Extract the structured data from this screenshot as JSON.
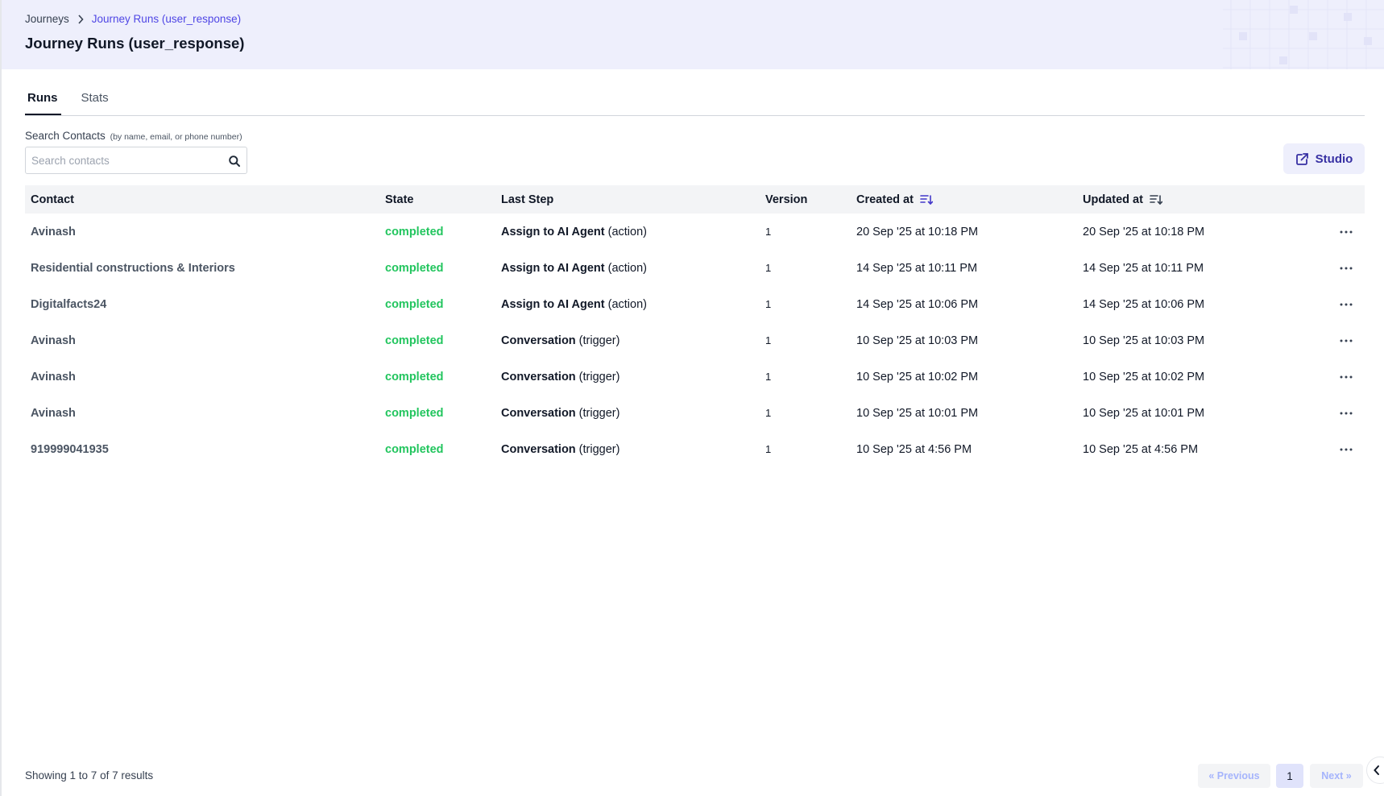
{
  "breadcrumb": {
    "root": "Journeys",
    "current": "Journey Runs (user_response)"
  },
  "page": {
    "title": "Journey Runs (user_response)"
  },
  "tabs": [
    {
      "label": "Runs",
      "active": true
    },
    {
      "label": "Stats",
      "active": false
    }
  ],
  "search": {
    "label": "Search Contacts",
    "hint": "(by name, email, or phone number)",
    "placeholder": "Search contacts",
    "value": ""
  },
  "studio_button": {
    "label": "Studio",
    "icon": "external-link-icon"
  },
  "table": {
    "headers": {
      "contact": "Contact",
      "state": "State",
      "last_step": "Last Step",
      "version": "Version",
      "created_at": "Created at",
      "updated_at": "Updated at"
    },
    "rows": [
      {
        "contact": "Avinash",
        "state": "completed",
        "step_name": "Assign to AI Agent",
        "step_type": "(action)",
        "version": "1",
        "created": "20 Sep '25 at 10:18 PM",
        "updated": "20 Sep '25 at 10:18 PM"
      },
      {
        "contact": "Residential constructions & Interiors",
        "state": "completed",
        "step_name": "Assign to AI Agent",
        "step_type": "(action)",
        "version": "1",
        "created": "14 Sep '25 at 10:11 PM",
        "updated": "14 Sep '25 at 10:11 PM"
      },
      {
        "contact": "Digitalfacts24",
        "state": "completed",
        "step_name": "Assign to AI Agent",
        "step_type": "(action)",
        "version": "1",
        "created": "14 Sep '25 at 10:06 PM",
        "updated": "14 Sep '25 at 10:06 PM"
      },
      {
        "contact": "Avinash",
        "state": "completed",
        "step_name": "Conversation",
        "step_type": "(trigger)",
        "version": "1",
        "created": "10 Sep '25 at 10:03 PM",
        "updated": "10 Sep '25 at 10:03 PM"
      },
      {
        "contact": "Avinash",
        "state": "completed",
        "step_name": "Conversation",
        "step_type": "(trigger)",
        "version": "1",
        "created": "10 Sep '25 at 10:02 PM",
        "updated": "10 Sep '25 at 10:02 PM"
      },
      {
        "contact": "Avinash",
        "state": "completed",
        "step_name": "Conversation",
        "step_type": "(trigger)",
        "version": "1",
        "created": "10 Sep '25 at 10:01 PM",
        "updated": "10 Sep '25 at 10:01 PM"
      },
      {
        "contact": "919999041935",
        "state": "completed",
        "step_name": "Conversation",
        "step_type": "(trigger)",
        "version": "1",
        "created": "10 Sep '25 at 4:56 PM",
        "updated": "10 Sep '25 at 4:56 PM"
      }
    ]
  },
  "footer": {
    "summary": "Showing 1 to 7 of 7 results",
    "prev": "« Previous",
    "page": "1",
    "next": "Next »"
  },
  "colors": {
    "accent": "#4f46e5",
    "header_bg": "#eeeffc",
    "state_completed": "#22c55e"
  }
}
